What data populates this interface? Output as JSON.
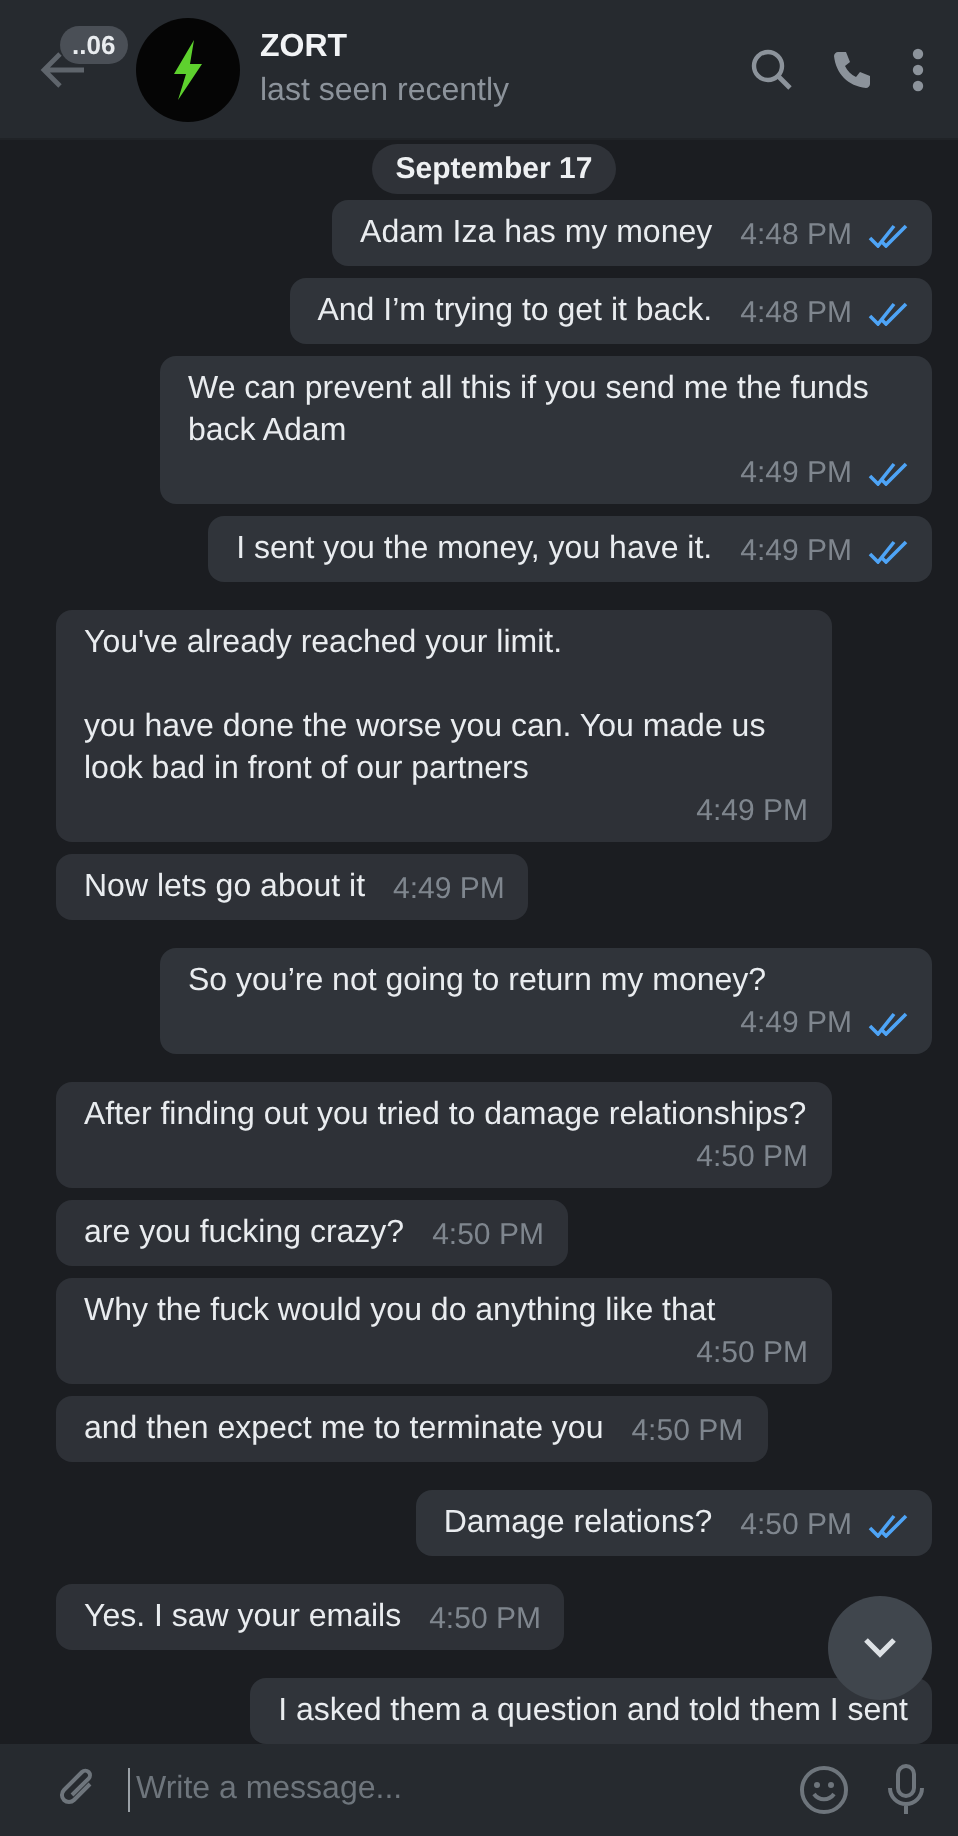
{
  "header": {
    "back_badge": "..06",
    "title": "ZORT",
    "status": "last seen recently"
  },
  "date_pill": "September 17",
  "messages": [
    {
      "kind": "outgoing",
      "text": "Adam Iza has my money",
      "time": "4:48 PM",
      "read": true
    },
    {
      "kind": "outgoing",
      "text": "And I’m trying to get it back.",
      "time": "4:48 PM",
      "read": true
    },
    {
      "kind": "outgoing",
      "text": "We can prevent all this if you send me the funds back Adam",
      "time": "4:49 PM",
      "read": true
    },
    {
      "kind": "outgoing",
      "text": "I sent you the money, you have it.",
      "time": "4:49 PM",
      "read": true
    },
    {
      "kind": "incoming",
      "text": "You've already reached your limit.\n\nyou have done the worse you can. You made us look bad in front of our partners",
      "time": "4:49 PM"
    },
    {
      "kind": "incoming",
      "text": "Now lets go about it",
      "time": "4:49 PM"
    },
    {
      "kind": "outgoing",
      "text": "So you’re not going to return my money?",
      "time": "4:49 PM",
      "read": true
    },
    {
      "kind": "incoming",
      "text": "After finding out you tried to damage relationships?",
      "time": "4:50 PM"
    },
    {
      "kind": "incoming",
      "text": "are you fucking crazy?",
      "time": "4:50 PM"
    },
    {
      "kind": "incoming",
      "text": "Why the fuck would you do anything like that",
      "time": "4:50 PM"
    },
    {
      "kind": "incoming",
      "text": "and then expect me to terminate you",
      "time": "4:50 PM"
    },
    {
      "kind": "outgoing",
      "text": "Damage relations?",
      "time": "4:50 PM",
      "read": true
    },
    {
      "kind": "incoming",
      "text": "Yes. I saw your emails",
      "time": "4:50 PM"
    },
    {
      "kind": "outgoing",
      "text": "I asked them a question and told them I sent"
    }
  ],
  "composer": {
    "placeholder": "Write a message..."
  }
}
